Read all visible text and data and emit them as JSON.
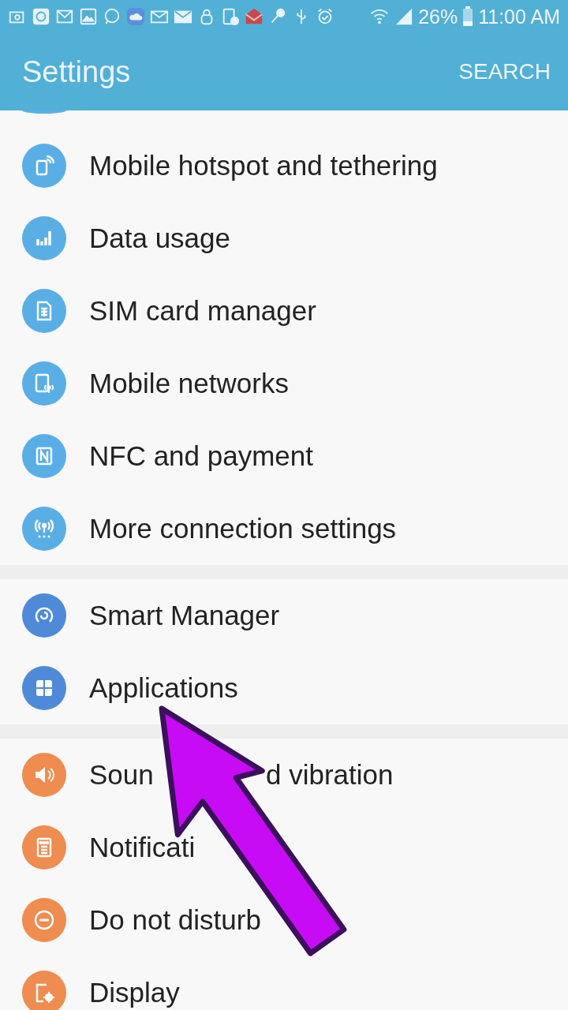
{
  "status_bar": {
    "battery": "26%",
    "time": "11:00 AM"
  },
  "app_bar": {
    "title": "Settings",
    "action": "SEARCH"
  },
  "groups": [
    {
      "color": "#5aaee6",
      "partial_above": true,
      "items": [
        {
          "label": "Mobile hotspot and tethering",
          "kind": "hotspot"
        },
        {
          "label": "Data usage",
          "kind": "bars"
        },
        {
          "label": "SIM card manager",
          "kind": "sim"
        },
        {
          "label": "Mobile networks",
          "kind": "network"
        },
        {
          "label": "NFC and payment",
          "kind": "nfc"
        },
        {
          "label": "More connection settings",
          "kind": "antenna"
        }
      ]
    },
    {
      "color": "#4e8ad8",
      "partial_above": false,
      "items": [
        {
          "label": "Smart Manager",
          "kind": "refresh"
        },
        {
          "label": "Applications",
          "kind": "grid"
        }
      ]
    },
    {
      "color": "#ef8c4f",
      "partial_above": false,
      "items": [
        {
          "label_parts": [
            "Soun",
            "d vibration"
          ],
          "kind": "speaker"
        },
        {
          "label_parts": [
            "Notificati"
          ],
          "kind": "notes"
        },
        {
          "label": "Do not disturb",
          "kind": "minus"
        },
        {
          "label": "Display",
          "kind": "display"
        }
      ]
    }
  ],
  "annotation": {
    "kind": "arrow"
  }
}
